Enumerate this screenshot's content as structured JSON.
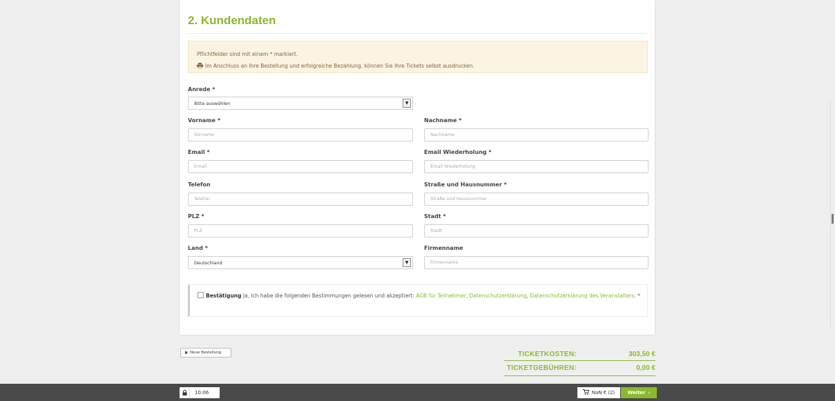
{
  "section": {
    "title": "2. Kundendaten"
  },
  "notice": {
    "required_hint": "Pflichtfelder sind mit einem * markiert.",
    "print_hint": "Im Anschluss an Ihre Bestellung und erfolgreiche Bezahlung, können Sie Ihre Tickets selbst ausdrucken.",
    "icon": "printer-icon"
  },
  "form": {
    "salutation": {
      "label": "Anrede *",
      "value": "Bitte auswählen"
    },
    "first_name": {
      "label": "Vorname *",
      "placeholder": "Vorname"
    },
    "last_name": {
      "label": "Nachname *",
      "placeholder": "Nachname"
    },
    "email": {
      "label": "Email *",
      "placeholder": "Email"
    },
    "email_repeat": {
      "label": "Email Wiederholung *",
      "placeholder": "Email Wiederholung"
    },
    "phone": {
      "label": "Telefon",
      "placeholder": "Telefon"
    },
    "street": {
      "label": "Straße und Hausnummer *",
      "placeholder": "Straße und Hausnummer"
    },
    "zip": {
      "label": "PLZ *",
      "placeholder": "PLZ"
    },
    "city": {
      "label": "Stadt *",
      "placeholder": "Stadt"
    },
    "country": {
      "label": "Land *",
      "value": "Deutschland"
    },
    "company": {
      "label": "Firmenname",
      "placeholder": "Firmenname"
    }
  },
  "confirmation": {
    "bold_label": "Bestätigung",
    "text": " Ja, ich habe die folgenden Bestimmungen gelesen und akzeptiert: ",
    "link_agb": "AGB für Teilnehmer",
    "sep1": ", ",
    "link_privacy": "Datenschutzerklärung",
    "sep2": ", ",
    "link_organizer_privacy": "Datenschutzerklärung des Veranstalters",
    "suffix": ". *"
  },
  "actions": {
    "new_order": "Neue Bestellung"
  },
  "summary": {
    "ticket_costs_label": "TICKETKOSTEN:",
    "ticket_costs_value": "303,50 €",
    "ticket_fees_label": "TICKETGEBÜHREN:",
    "ticket_fees_value": "0,00 €"
  },
  "bottom_bar": {
    "timer": "10:06",
    "cart": "NaN € (2)",
    "next": "Weiter"
  },
  "colors": {
    "accent": "#8ab92d",
    "notice_bg": "#fbf4e2",
    "bar_bg": "#4a4a4a"
  }
}
